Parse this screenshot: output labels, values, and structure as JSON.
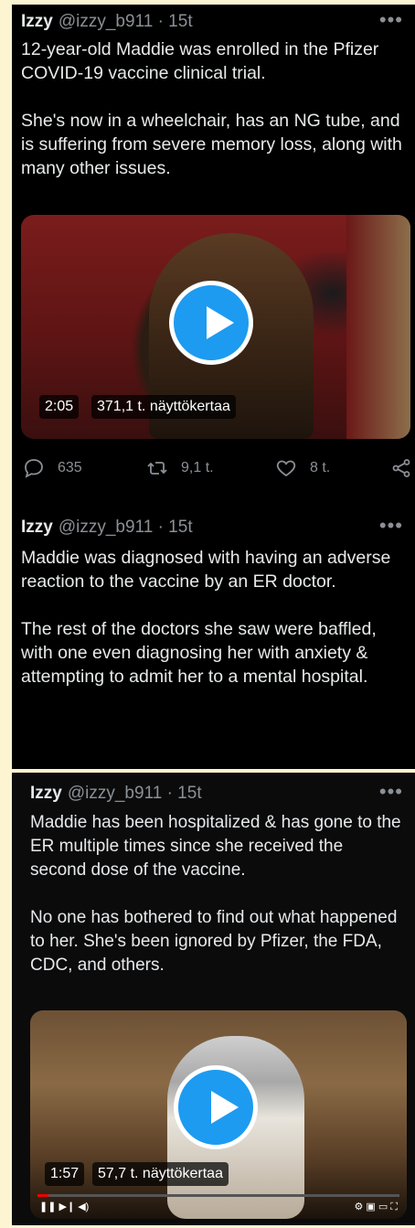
{
  "tweets": [
    {
      "name": "Izzy",
      "handle": "@izzy_b911",
      "time": "· 15t",
      "paragraphs": [
        "12-year-old Maddie was enrolled in the Pfizer COVID-19 vaccine clinical trial.",
        "She's now in a wheelchair, has an NG tube, and is suffering from severe memory loss, along with many other issues."
      ],
      "video": {
        "duration": "2:05",
        "views": "371,1 t. näyttökertaa"
      },
      "stats": {
        "replies": "635",
        "retweets": "9,1 t.",
        "likes": "8 t."
      }
    },
    {
      "name": "Izzy",
      "handle": "@izzy_b911",
      "time": "· 15t",
      "paragraphs": [
        "Maddie was diagnosed with having an adverse reaction to the vaccine by an ER doctor.",
        "The rest of the doctors she saw were baffled, with one even diagnosing her with anxiety & attempting to admit her to a mental hospital."
      ]
    },
    {
      "name": "Izzy",
      "handle": "@izzy_b911",
      "time": "· 15t",
      "paragraphs": [
        "Maddie has been hospitalized & has gone to the ER multiple times since she received the second dose of the vaccine.",
        "No one has bothered to find out what happened to her. She's been ignored by Pfizer, the FDA, CDC, and others."
      ],
      "video": {
        "duration": "1:57",
        "views": "57,7 t. näyttökertaa"
      }
    }
  ],
  "more_icon": "•••",
  "icons": [
    "reply-icon",
    "retweet-icon",
    "like-icon",
    "share-icon",
    "play-icon"
  ]
}
